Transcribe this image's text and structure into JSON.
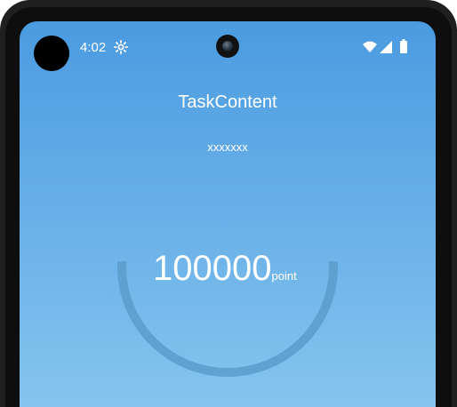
{
  "status_bar": {
    "time": "4:02",
    "icons": [
      "gear-icon",
      "wifi-icon",
      "signal-icon",
      "battery-icon"
    ]
  },
  "header": {
    "title": "TaskContent",
    "subtitle": "xxxxxxx"
  },
  "points": {
    "value": "100000",
    "unit": "point"
  },
  "colors": {
    "background_top": "#4b9be1",
    "background_bottom": "#86c4ef",
    "gauge_stroke": "#5a9ccb",
    "text": "#ffffff"
  }
}
